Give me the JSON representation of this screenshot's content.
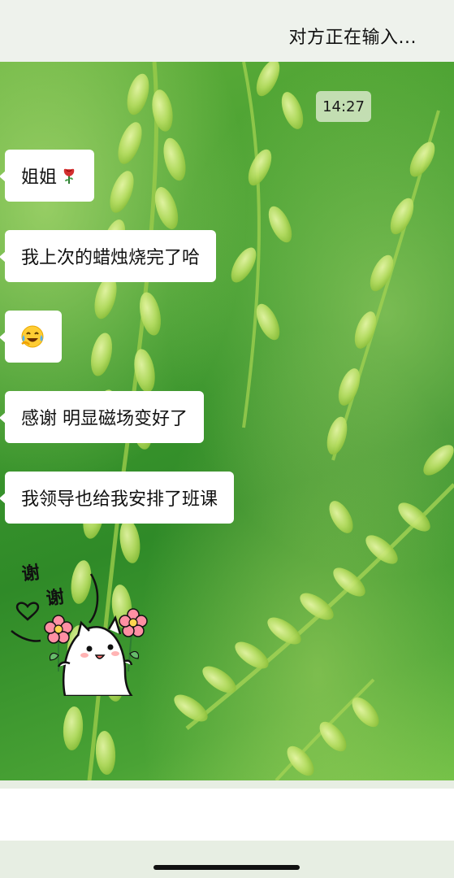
{
  "header": {
    "status_title": "对方正在输入..."
  },
  "chat": {
    "timestamp": "14:27",
    "messages": [
      {
        "text": "姐姐",
        "emoji": "rose-icon"
      },
      {
        "text": "我上次的蜡烛烧完了哈"
      },
      {
        "text": "",
        "emoji": "laughing-tears-icon"
      },
      {
        "text": "感谢 明显磁场变好了"
      },
      {
        "text": "我领导也给我安排了班课"
      }
    ],
    "sticker": {
      "text": "谢谢",
      "name": "thank-you-cat-sticker"
    }
  },
  "colors": {
    "bubble": "#ffffff",
    "background_green": "#3f9a2e",
    "header_bg": "#eef2ec"
  }
}
